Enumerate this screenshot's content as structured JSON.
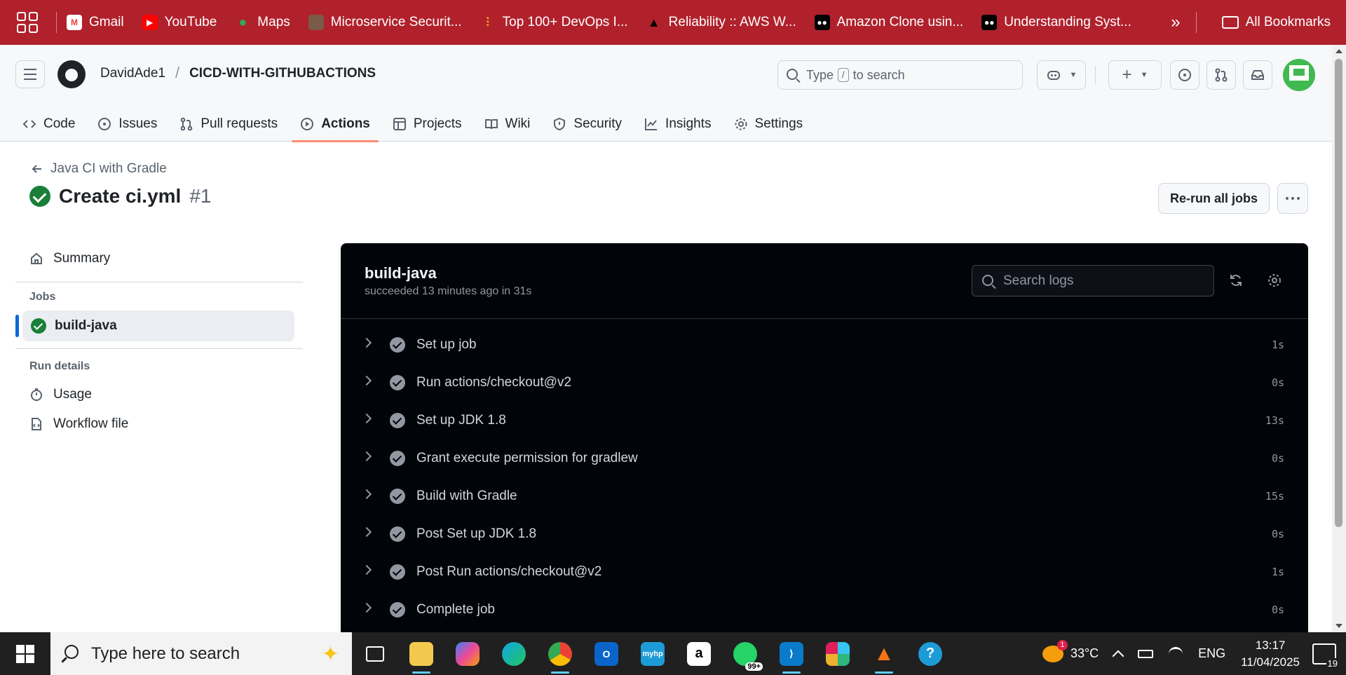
{
  "bookmarks": {
    "items": [
      {
        "label": "Gmail",
        "icon": "gmail-icon"
      },
      {
        "label": "YouTube",
        "icon": "youtube-icon"
      },
      {
        "label": "Maps",
        "icon": "maps-icon"
      },
      {
        "label": "Microservice Securit...",
        "icon": "avatar-icon"
      },
      {
        "label": "Top 100+ DevOps I...",
        "icon": "devops-icon"
      },
      {
        "label": "Reliability :: AWS W...",
        "icon": "graduation-cap-icon"
      },
      {
        "label": "Amazon Clone usin...",
        "icon": "medium-icon"
      },
      {
        "label": "Understanding Syst...",
        "icon": "medium-icon"
      }
    ],
    "more": "»",
    "all_bookmarks": "All Bookmarks"
  },
  "header": {
    "owner": "DavidAde1",
    "separator": "/",
    "repo": "CICD-WITH-GITHUBACTIONS",
    "search_prefix": "Type",
    "search_key": "/",
    "search_suffix": "to search"
  },
  "tabs": [
    {
      "label": "Code",
      "icon": "code-icon"
    },
    {
      "label": "Issues",
      "icon": "issue-icon"
    },
    {
      "label": "Pull requests",
      "icon": "pull-request-icon"
    },
    {
      "label": "Actions",
      "icon": "play-icon",
      "active": true
    },
    {
      "label": "Projects",
      "icon": "table-icon"
    },
    {
      "label": "Wiki",
      "icon": "book-icon"
    },
    {
      "label": "Security",
      "icon": "shield-icon"
    },
    {
      "label": "Insights",
      "icon": "graph-icon"
    },
    {
      "label": "Settings",
      "icon": "gear-icon"
    }
  ],
  "run": {
    "back_label": "Java CI with Gradle",
    "title": "Create ci.yml",
    "number": "#1",
    "rerun_label": "Re-run all jobs"
  },
  "sidebar": {
    "summary": "Summary",
    "jobs_heading": "Jobs",
    "job": "build-java",
    "run_details_heading": "Run details",
    "usage": "Usage",
    "workflow_file": "Workflow file"
  },
  "logs": {
    "job_name": "build-java",
    "meta": "succeeded 13 minutes ago in 31s",
    "search_placeholder": "Search logs",
    "steps": [
      {
        "label": "Set up job",
        "duration": "1s"
      },
      {
        "label": "Run actions/checkout@v2",
        "duration": "0s"
      },
      {
        "label": "Set up JDK 1.8",
        "duration": "13s"
      },
      {
        "label": "Grant execute permission for gradlew",
        "duration": "0s"
      },
      {
        "label": "Build with Gradle",
        "duration": "15s"
      },
      {
        "label": "Post Set up JDK 1.8",
        "duration": "0s"
      },
      {
        "label": "Post Run actions/checkout@v2",
        "duration": "1s"
      },
      {
        "label": "Complete job",
        "duration": "0s"
      }
    ]
  },
  "taskbar": {
    "search_placeholder": "Type here to search",
    "whatsapp_badge": "99+",
    "weather_badge": "1",
    "temperature": "33°C",
    "language": "ENG",
    "time": "13:17",
    "date": "11/04/2025",
    "notifications": "19"
  },
  "colors": {
    "bookmarks_bar": "#b0212c",
    "success": "#1a7f37",
    "active_tab_underline": "#fd8c73",
    "logs_background": "#010409"
  }
}
